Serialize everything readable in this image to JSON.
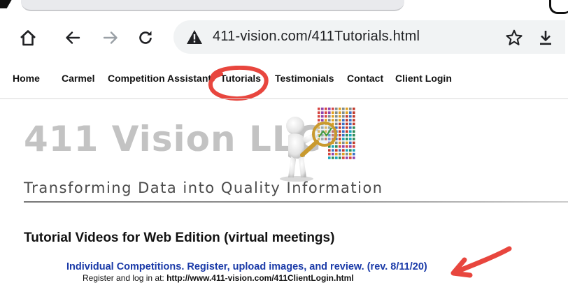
{
  "browser": {
    "url": "411-vision.com/411Tutorials.html",
    "icons": [
      "home-icon",
      "back-arrow-icon",
      "forward-arrow-icon",
      "reload-icon",
      "warning-icon",
      "star-icon",
      "download-icon"
    ]
  },
  "nav": {
    "items": [
      {
        "label": "Home"
      },
      {
        "label": "Carmel"
      },
      {
        "label": "Competition Assistant"
      },
      {
        "label": "Tutorials"
      },
      {
        "label": "Testimonials"
      },
      {
        "label": "Contact"
      },
      {
        "label": "Client Login"
      }
    ]
  },
  "banner": {
    "logo": "411 Vision LLC",
    "tagline": "Transforming Data into Quality Information"
  },
  "content": {
    "section_title": "Tutorial Videos for Web Edition (virtual meetings)",
    "video_link": "Individual Competitions. Register, upload images, and review. (rev. 8/11/20)",
    "register_prefix": "Register and log in at: ",
    "register_url": "http://www.411-vision.com/411ClientLogin.html"
  },
  "colors": {
    "annotation": "#e8463e",
    "link": "#1a3aa8",
    "logo_gray": "#c3c3c3"
  }
}
